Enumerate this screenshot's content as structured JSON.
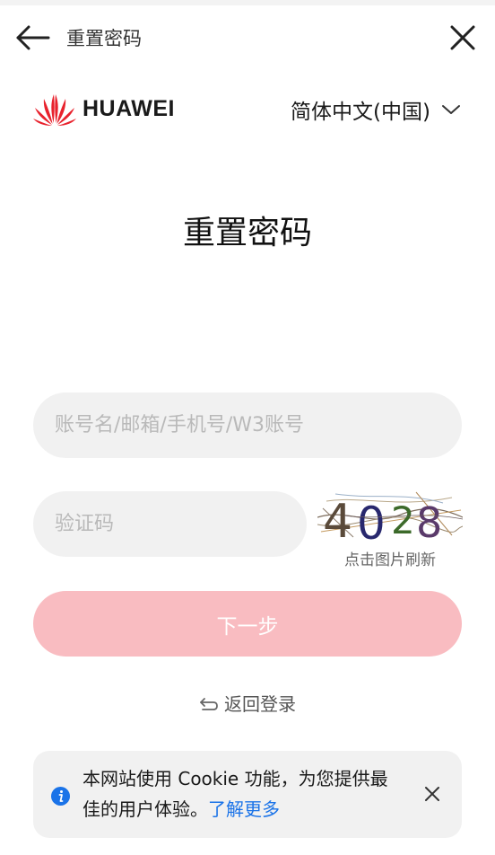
{
  "topbar": {
    "title": "重置密码",
    "back_icon": "arrow-left-icon",
    "close_icon": "close-icon"
  },
  "brand": {
    "name": "HUAWEI",
    "logo_icon": "huawei-flower-logo",
    "logo_color": "#e8222d"
  },
  "language": {
    "selected": "简体中文(中国)",
    "chevron_icon": "chevron-down-icon"
  },
  "page_title": "重置密码",
  "form": {
    "account_placeholder": "账号名/邮箱/手机号/W3账号",
    "account_value": "",
    "code_placeholder": "验证码",
    "code_value": "",
    "captcha_text": "4028",
    "captcha_hint": "点击图片刷新",
    "next_label": "下一步",
    "next_color": "#f9bcc1"
  },
  "back_login": {
    "label": "返回登录",
    "icon": "return-arrow-icon"
  },
  "cookie": {
    "text": "本网站使用 Cookie 功能，为您提供最佳的用户体验。",
    "link": "了解更多",
    "info_icon": "info-icon",
    "close_icon": "close-icon",
    "link_color": "#1a73e8",
    "info_color": "#1a73e8"
  }
}
